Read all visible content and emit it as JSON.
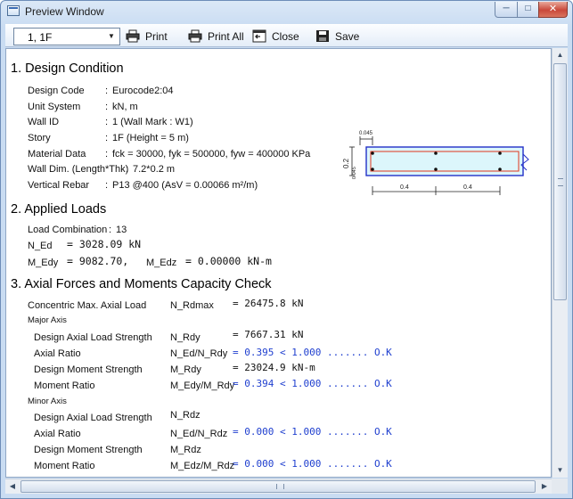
{
  "window": {
    "title": "Preview Window"
  },
  "toolbar": {
    "story_value": "1,     1F",
    "print_label": "Print",
    "print_all_label": "Print All",
    "close_label": "Close",
    "save_label": "Save"
  },
  "section1": {
    "heading": "1. Design Condition",
    "rows": [
      {
        "label": "Design Code",
        "sep": ":",
        "value": "Eurocode2:04"
      },
      {
        "label": "Unit System",
        "sep": ":",
        "value": "kN, m"
      },
      {
        "label": "Wall ID",
        "sep": ":",
        "value": "1  (Wall Mark : W1)"
      },
      {
        "label": "Story",
        "sep": ":",
        "value": "1F  (Height = 5 m)"
      },
      {
        "label": "Material Data",
        "sep": ":",
        "value": "fck = 30000,   fyk = 500000,   fyw = 400000 KPa"
      },
      {
        "label": "Wall Dim.  (Length*Thk)",
        "sep": ":",
        "value": "7.2*0.2 m"
      },
      {
        "label": "Vertical Rebar",
        "sep": ":",
        "value": "P13 @400 (AsV = 0.00066 m²/m)"
      }
    ],
    "diagram": {
      "dim_top": "0.045",
      "dim_height": "0.2",
      "dim_side": "0.045",
      "dim_left_span": "0.4",
      "dim_right_span": "0.4",
      "colors": {
        "wall_fill": "#dcf6fb",
        "wall_edge": "#2230c8",
        "rebar_line": "#e0371c"
      }
    }
  },
  "section2": {
    "heading": "2. Applied Loads",
    "load_combination_label": "Load Combination",
    "load_combination_sep": ":",
    "load_combination_value": "13",
    "n_ed_label": "N_Ed",
    "n_ed_value": "= 3028.09  kN",
    "m_edy_label": "M_Edy",
    "m_edy_value": "= 9082.70,",
    "m_edz_label": "M_Edz",
    "m_edz_value": "= 0.00000  kN-m"
  },
  "section3": {
    "heading": "3. Axial Forces and Moments Capacity Check",
    "concentric_label": "Concentric Max. Axial Load",
    "concentric_symbol": "N_Rdmax",
    "concentric_value": "= 26475.8  kN",
    "major_axis_label": "Major Axis",
    "major": [
      {
        "label": "Design Axial Load Strength",
        "symbol": "N_Rdy",
        "value": "= 7667.31  kN",
        "ok": false
      },
      {
        "label": "Axial Ratio",
        "symbol": "N_Ed/N_Rdy",
        "value": "= 0.395  < 1.000 ....... O.K",
        "ok": true
      },
      {
        "label": "Design Moment Strength",
        "symbol": "M_Rdy",
        "value": "= 23024.9  kN-m",
        "ok": false
      },
      {
        "label": "Moment Ratio",
        "symbol": "M_Edy/M_Rdy",
        "value": "= 0.394  < 1.000 ....... O.K",
        "ok": true
      }
    ],
    "minor_axis_label": "Minor Axis",
    "minor": [
      {
        "label": "Design Axial Load Strength",
        "symbol": "N_Rdz",
        "value": "",
        "ok": false
      },
      {
        "label": "Axial Ratio",
        "symbol": "N_Ed/N_Rdz",
        "value": "= 0.000  < 1.000 ....... O.K",
        "ok": true
      },
      {
        "label": "Design Moment Strength",
        "symbol": "M_Rdz",
        "value": "",
        "ok": false
      },
      {
        "label": "Moment Ratio",
        "symbol": "M_Edz/M_Rdz",
        "value": "= 0.000  < 1.000 ....... O.K",
        "ok": true
      }
    ]
  },
  "colors": {
    "ok_text": "#1f3fcf",
    "window_frame": "#c9dcf2",
    "close_button": "#c9483a"
  },
  "icons": [
    "app-window-icon",
    "minimize-icon",
    "maximize-icon",
    "close-icon",
    "printer-icon",
    "print-all-icon",
    "close-preview-icon",
    "floppy-disk-icon",
    "chevron-down-icon",
    "scroll-up-icon",
    "scroll-down-icon",
    "scroll-left-icon",
    "scroll-right-icon"
  ]
}
